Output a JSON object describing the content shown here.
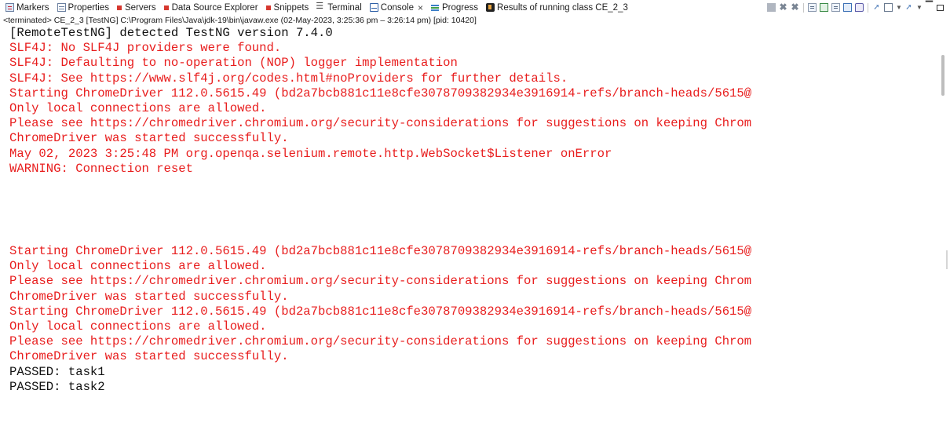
{
  "tabs": [
    {
      "label": "Markers",
      "icon": "markers-icon",
      "active": false
    },
    {
      "label": "Properties",
      "icon": "properties-icon",
      "active": false
    },
    {
      "label": "Servers",
      "icon": "servers-icon",
      "active": false
    },
    {
      "label": "Data Source Explorer",
      "icon": "data-source-explorer-icon",
      "active": false
    },
    {
      "label": "Snippets",
      "icon": "snippets-icon",
      "active": false
    },
    {
      "label": "Terminal",
      "icon": "terminal-icon",
      "active": false
    },
    {
      "label": "Console",
      "icon": "console-icon",
      "active": true,
      "close": "×"
    },
    {
      "label": "Progress",
      "icon": "progress-icon",
      "active": false
    },
    {
      "label": "Results of running class CE_2_3",
      "icon": "testng-results-icon",
      "active": false
    }
  ],
  "toolbar_icons": [
    "terminate-icon",
    "remove-launch-icon",
    "remove-all-terminated-icon",
    "scroll-lock-icon",
    "show-console-on-output-icon",
    "show-console-on-error-icon",
    "word-wrap-icon",
    "pin-console-icon",
    "display-selected-console-icon",
    "open-console-icon",
    "view-menu-icon",
    "minimize-icon",
    "maximize-icon"
  ],
  "status_line": "<terminated> CE_2_3 [TestNG] C:\\Program Files\\Java\\jdk-19\\bin\\javaw.exe  (02-May-2023, 3:25:36 pm – 3:26:14 pm) [pid: 10420]",
  "colors": {
    "stderr": "#e81d1d",
    "stdout": "#111111"
  },
  "console_top": [
    {
      "text": "[RemoteTestNG] detected TestNG version 7.4.0",
      "stream": "out"
    },
    {
      "text": "SLF4J: No SLF4J providers were found.",
      "stream": "err"
    },
    {
      "text": "SLF4J: Defaulting to no-operation (NOP) logger implementation",
      "stream": "err"
    },
    {
      "text": "SLF4J: See https://www.slf4j.org/codes.html#noProviders for further details.",
      "stream": "err"
    },
    {
      "text": "Starting ChromeDriver 112.0.5615.49 (bd2a7bcb881c11e8cfe3078709382934e3916914-refs/branch-heads/5615@",
      "stream": "err"
    },
    {
      "text": "Only local connections are allowed.",
      "stream": "err"
    },
    {
      "text": "Please see https://chromedriver.chromium.org/security-considerations for suggestions on keeping Chrom",
      "stream": "err"
    },
    {
      "text": "ChromeDriver was started successfully.",
      "stream": "err"
    },
    {
      "text": "May 02, 2023 3:25:48 PM org.openqa.selenium.remote.http.WebSocket$Listener onError",
      "stream": "err"
    },
    {
      "text": "WARNING: Connection reset",
      "stream": "err"
    }
  ],
  "console_bottom": [
    {
      "text": "Starting ChromeDriver 112.0.5615.49 (bd2a7bcb881c11e8cfe3078709382934e3916914-refs/branch-heads/5615@",
      "stream": "err"
    },
    {
      "text": "Only local connections are allowed.",
      "stream": "err"
    },
    {
      "text": "Please see https://chromedriver.chromium.org/security-considerations for suggestions on keeping Chrom",
      "stream": "err"
    },
    {
      "text": "ChromeDriver was started successfully.",
      "stream": "err"
    },
    {
      "text": "Starting ChromeDriver 112.0.5615.49 (bd2a7bcb881c11e8cfe3078709382934e3916914-refs/branch-heads/5615@",
      "stream": "err"
    },
    {
      "text": "Only local connections are allowed.",
      "stream": "err"
    },
    {
      "text": "Please see https://chromedriver.chromium.org/security-considerations for suggestions on keeping Chrom",
      "stream": "err"
    },
    {
      "text": "ChromeDriver was started successfully.",
      "stream": "err"
    },
    {
      "text": "PASSED: task1",
      "stream": "out"
    },
    {
      "text": "PASSED: task2",
      "stream": "out"
    }
  ]
}
